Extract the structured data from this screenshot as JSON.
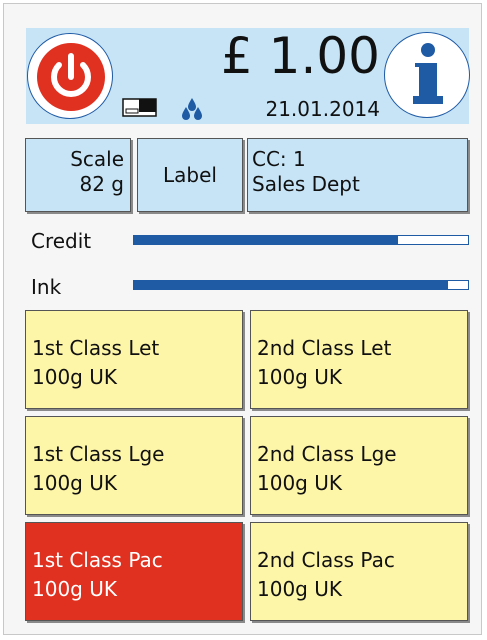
{
  "header": {
    "amount": "£ 1.00",
    "date": "21.01.2014",
    "power_icon": "power-icon",
    "info_icon": "info-icon",
    "card_icon": "card-icon",
    "ink_icon": "ink-drops-icon"
  },
  "controls": {
    "scale": {
      "title": "Scale",
      "weight": "82 g"
    },
    "label": "Label",
    "cost_centre": {
      "line1": "CC: 1",
      "line2": "Sales Dept"
    }
  },
  "gauges": [
    {
      "label": "Credit",
      "level": 0.79
    },
    {
      "label": "Ink",
      "level": 0.94
    }
  ],
  "services": [
    {
      "line1": "1st Class Let",
      "line2": "100g UK",
      "selected": false
    },
    {
      "line1": "2nd Class Let",
      "line2": "100g UK",
      "selected": false
    },
    {
      "line1": "1st Class Lge",
      "line2": "100g UK",
      "selected": false
    },
    {
      "line1": "2nd Class Lge",
      "line2": "100g UK",
      "selected": false
    },
    {
      "line1": "1st Class Pac",
      "line2": "100g UK",
      "selected": true
    },
    {
      "line1": "2nd Class Pac",
      "line2": "100g UK",
      "selected": false
    }
  ],
  "colors": {
    "header_bg": "#c6e4f6",
    "accent_blue": "#1f5aa5",
    "power_red": "#e03020",
    "service_bg": "#fdf5a8",
    "selected_bg": "#e03020"
  }
}
